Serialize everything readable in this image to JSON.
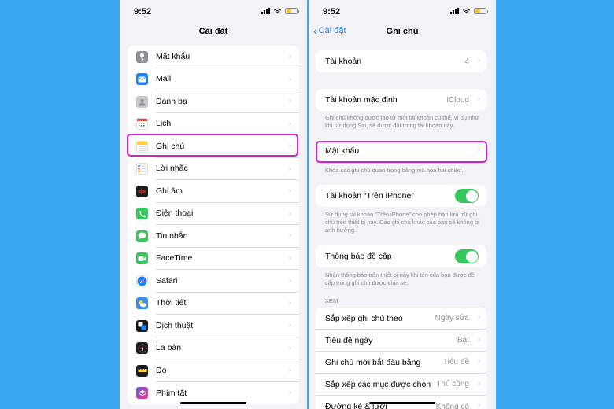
{
  "left": {
    "time": "9:52",
    "title": "Cài đặt",
    "items": [
      {
        "label": "Mật khẩu",
        "icon": "key-icon",
        "color": "#8e8e93"
      },
      {
        "label": "Mail",
        "icon": "mail-icon",
        "color": "#1a82fb"
      },
      {
        "label": "Danh bạ",
        "icon": "contacts-icon",
        "color": "#b9b9bd"
      },
      {
        "label": "Lịch",
        "icon": "calendar-icon",
        "color": "#ffffff"
      },
      {
        "label": "Ghi chú",
        "icon": "notes-icon",
        "color": "#ffd23a"
      },
      {
        "label": "Lời nhắc",
        "icon": "reminders-icon",
        "color": "#ffffff"
      },
      {
        "label": "Ghi âm",
        "icon": "voice-memos-icon",
        "color": "#1c1c1e"
      },
      {
        "label": "Điện thoại",
        "icon": "phone-icon",
        "color": "#34c759"
      },
      {
        "label": "Tin nhắn",
        "icon": "messages-icon",
        "color": "#34c759"
      },
      {
        "label": "FaceTime",
        "icon": "facetime-icon",
        "color": "#34c759"
      },
      {
        "label": "Safari",
        "icon": "safari-icon",
        "color": "#1a82fb"
      },
      {
        "label": "Thời tiết",
        "icon": "weather-icon",
        "color": "#3b8ff0"
      },
      {
        "label": "Dịch thuật",
        "icon": "translate-icon",
        "color": "#1c1c1e"
      },
      {
        "label": "La bàn",
        "icon": "compass-icon",
        "color": "#1c1c1e"
      },
      {
        "label": "Đo",
        "icon": "measure-icon",
        "color": "#1c1c1e"
      },
      {
        "label": "Phím tắt",
        "icon": "shortcuts-icon",
        "color": "#5e5ce6"
      }
    ]
  },
  "right": {
    "time": "9:52",
    "back_label": "Cài đặt",
    "title": "Ghi chú",
    "accounts": {
      "label": "Tài khoản",
      "value": "4"
    },
    "default_account": {
      "label": "Tài khoản mặc định",
      "value": "iCloud"
    },
    "default_note": "Ghi chú không được tạo từ một tài khoản cụ thể, ví dụ như khi sử dụng Siri, sẽ được đặt trong tài khoản này.",
    "password": {
      "label": "Mật khẩu"
    },
    "password_note": "Khóa các ghi chú quan trọng bằng mã hóa hai chiều.",
    "on_iphone": {
      "label": "Tài khoản “Trên iPhone”",
      "on": true
    },
    "on_iphone_note": "Sử dụng tài khoản “Trên iPhone” cho phép bạn lưu trữ ghi chú trên thiết bị này. Các ghi chú khác của bạn sẽ không bị ảnh hưởng.",
    "mention": {
      "label": "Thông báo đề cập",
      "on": true
    },
    "mention_note": "Nhận thông báo trên thiết bị này khi tên của bạn được đề cập trong ghi chú được chia sẻ.",
    "view_header": "XEM",
    "view_items": [
      {
        "label": "Sắp xếp ghi chú theo",
        "value": "Ngày sửa"
      },
      {
        "label": "Tiêu đề ngày",
        "value": "Bật"
      },
      {
        "label": "Ghi chú mới bắt đầu bằng",
        "value": "Tiêu đề"
      },
      {
        "label": "Sắp xếp các mục được chọn",
        "value": "Thủ công"
      },
      {
        "label": "Đường kẻ & lưới",
        "value": "Không có"
      }
    ]
  },
  "colors": {
    "highlight": "#d81bd4",
    "toggle": "#34c759",
    "link": "#147efb",
    "background": "#3aa6f2"
  }
}
